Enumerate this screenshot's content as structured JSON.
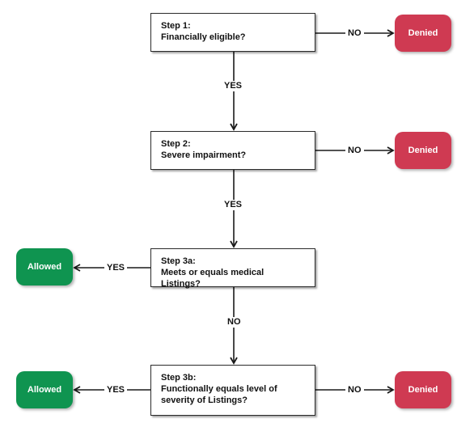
{
  "steps": [
    {
      "id": "step1",
      "title": "Step 1:",
      "question": "Financially eligible?"
    },
    {
      "id": "step2",
      "title": "Step 2:",
      "question": "Severe impairment?"
    },
    {
      "id": "step3a",
      "title": "Step 3a:",
      "question": "Meets or equals medical Listings?"
    },
    {
      "id": "step3b",
      "title": "Step 3b:",
      "question": "Functionally equals level of severity of Listings?"
    }
  ],
  "outcomes": {
    "denied": "Denied",
    "allowed": "Allowed"
  },
  "edges": [
    {
      "from": "step1",
      "to": "denied-1",
      "label": "NO"
    },
    {
      "from": "step1",
      "to": "step2",
      "label": "YES"
    },
    {
      "from": "step2",
      "to": "denied-2",
      "label": "NO"
    },
    {
      "from": "step2",
      "to": "step3a",
      "label": "YES"
    },
    {
      "from": "step3a",
      "to": "allowed-1",
      "label": "YES"
    },
    {
      "from": "step3a",
      "to": "step3b",
      "label": "NO"
    },
    {
      "from": "step3b",
      "to": "allowed-2",
      "label": "YES"
    },
    {
      "from": "step3b",
      "to": "denied-3",
      "label": "NO"
    }
  ],
  "colors": {
    "denied": "#cf3a52",
    "allowed": "#0f9450",
    "line": "#1a1a1a"
  }
}
